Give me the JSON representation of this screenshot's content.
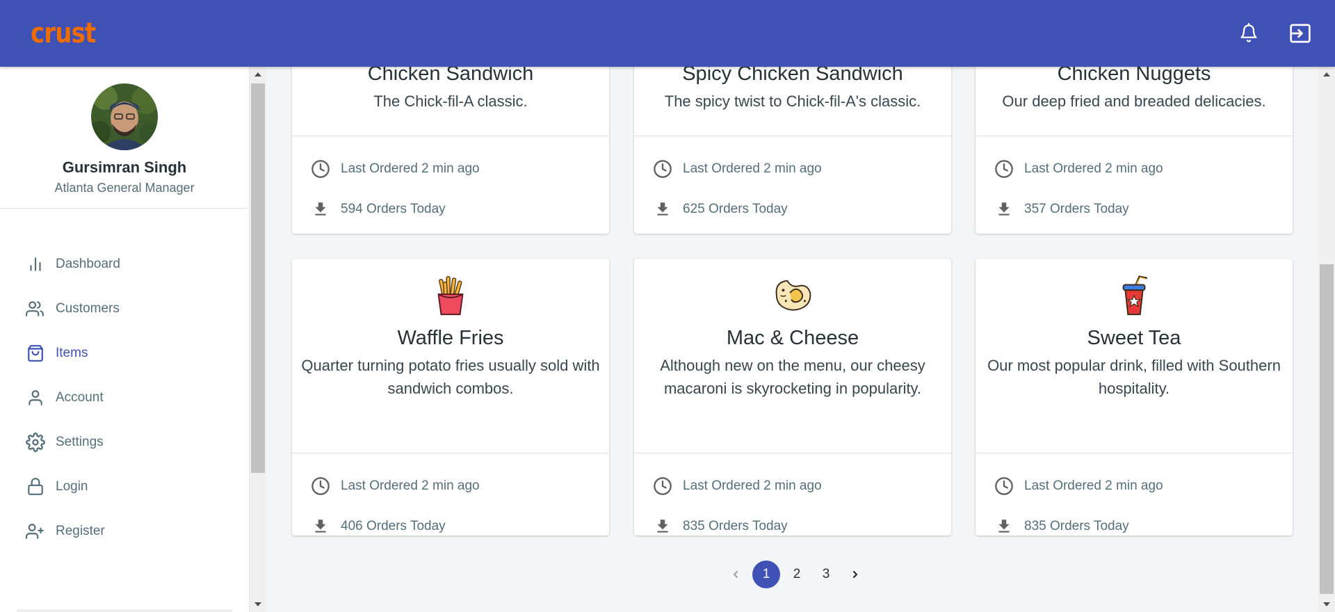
{
  "app": {
    "brand": "crust"
  },
  "topbar": {
    "notifications_icon": "bell-icon",
    "logout_icon": "logout-icon",
    "color": "#3f51b5",
    "brand_color": "#ef6c00"
  },
  "profile": {
    "name": "Gursimran Singh",
    "role": "Atlanta General Manager"
  },
  "sidebar": {
    "items": [
      {
        "label": "Dashboard",
        "icon": "bar-chart-icon",
        "active": false
      },
      {
        "label": "Customers",
        "icon": "users-icon",
        "active": false
      },
      {
        "label": "Items",
        "icon": "shopping-bag-icon",
        "active": true
      },
      {
        "label": "Account",
        "icon": "user-icon",
        "active": false
      },
      {
        "label": "Settings",
        "icon": "gear-icon",
        "active": false
      },
      {
        "label": "Login",
        "icon": "lock-icon",
        "active": false
      },
      {
        "label": "Register",
        "icon": "user-plus-icon",
        "active": false
      }
    ]
  },
  "cards": [
    {
      "title": "Chicken Sandwich",
      "description": "The Chick-fil-A classic.",
      "last_ordered": "Last Ordered 2 min ago",
      "orders": "594 Orders Today"
    },
    {
      "title": "Spicy Chicken Sandwich",
      "description": "The spicy twist to Chick-fil-A's classic.",
      "last_ordered": "Last Ordered 2 min ago",
      "orders": "625 Orders Today"
    },
    {
      "title": "Chicken Nuggets",
      "description": "Our deep fried and breaded delicacies.",
      "last_ordered": "Last Ordered 2 min ago",
      "orders": "357 Orders Today"
    },
    {
      "title": "Waffle Fries",
      "icon": "fries-icon",
      "description": "Quarter turning potato fries usually sold with sandwich combos.",
      "last_ordered": "Last Ordered 2 min ago",
      "orders": "406 Orders Today"
    },
    {
      "title": "Mac & Cheese",
      "icon": "mac-cheese-icon",
      "description": "Although new on the menu, our cheesy macaroni is skyrocketing in popularity.",
      "last_ordered": "Last Ordered 2 min ago",
      "orders": "835 Orders Today"
    },
    {
      "title": "Sweet Tea",
      "icon": "drink-cup-icon",
      "description": "Our most popular drink, filled with Southern hospitality.",
      "last_ordered": "Last Ordered 2 min ago",
      "orders": "835 Orders Today"
    }
  ],
  "pagination": {
    "pages": [
      "1",
      "2",
      "3"
    ],
    "current": "1"
  }
}
